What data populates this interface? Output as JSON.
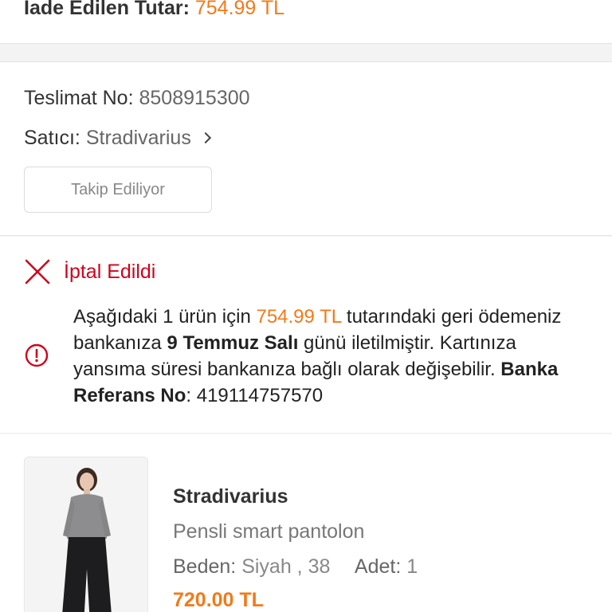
{
  "refund": {
    "label": "İade Edilen Tutar:",
    "amount": "754.99 TL"
  },
  "delivery": {
    "number_label": "Teslimat No:",
    "number_value": "8508915300",
    "seller_label": "Satıcı:",
    "seller_value": "Stradivarius",
    "follow_button": "Takip Ediliyor"
  },
  "cancel": {
    "title": "İptal Edildi",
    "message": {
      "part1": "Aşağıdaki 1 ürün için ",
      "amount": "754.99 TL",
      "part2": " tutarındaki geri ödemeniz bankanıza ",
      "date": "9 Temmuz Salı",
      "part3": " günü iletilmiştir. Kartınıza yansıma süresi bankanıza bağlı olarak değişebilir. ",
      "ref_label": "Banka Referans No",
      "ref_sep": ": ",
      "ref_value": "419114757570"
    }
  },
  "product": {
    "brand": "Stradivarius",
    "name": "Pensli smart pantolon",
    "size_label": "Beden:",
    "size_value": "Siyah , 38",
    "qty_label": "Adet:",
    "qty_value": "1",
    "price": "720.00 TL"
  },
  "colors": {
    "accent": "#f27a1a",
    "cancel_red": "#d0021b"
  },
  "icons": {
    "cancel": "close-icon",
    "info": "info-icon",
    "seller": "chevron-right-icon"
  }
}
